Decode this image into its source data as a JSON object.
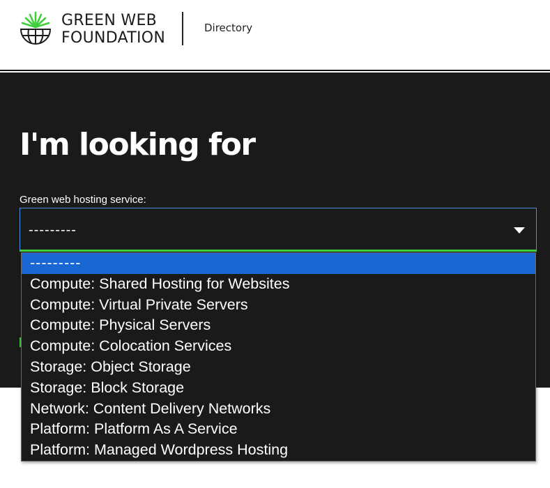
{
  "header": {
    "logo_line1": "GREEN WEB",
    "logo_line2": "FOUNDATION",
    "nav_link": "Directory"
  },
  "hero": {
    "title": "I'm looking for",
    "field_label": "Green web hosting service:",
    "select_value": "---------"
  },
  "dropdown": {
    "options": [
      "---------",
      "Compute: Shared Hosting for Websites",
      "Compute: Virtual Private Servers",
      "Compute: Physical Servers",
      "Compute: Colocation Services",
      "Storage: Object Storage",
      "Storage: Block Storage",
      "Network: Content Delivery Networks",
      "Platform: Platform As A Service",
      "Platform: Managed Wordpress Hosting"
    ],
    "highlighted_index": 0
  },
  "colors": {
    "brand_green": "#3fcf3a",
    "hero_bg": "#1a1a1a",
    "highlight_blue": "#1a66d2"
  }
}
